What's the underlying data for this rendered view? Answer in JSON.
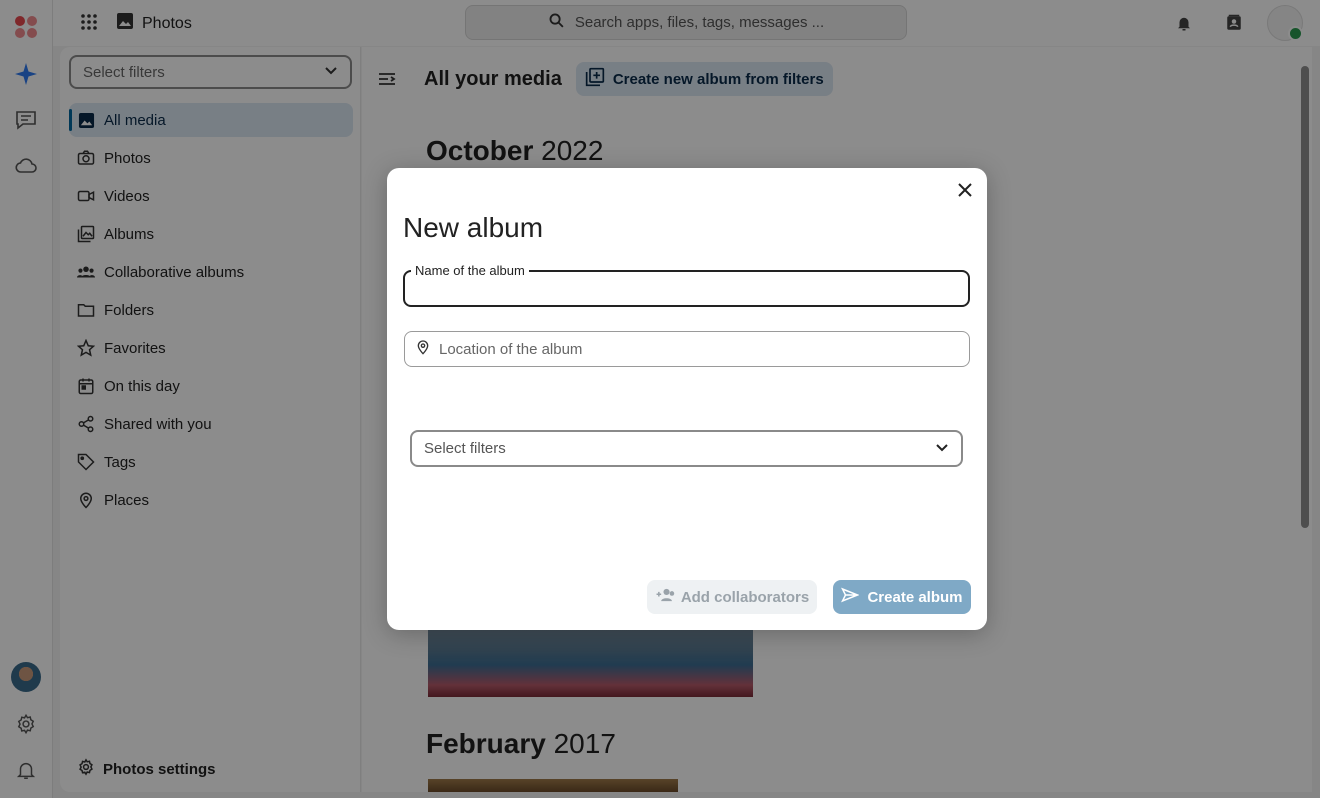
{
  "app": {
    "title": "Photos"
  },
  "search": {
    "placeholder": "Search apps, files, tags, messages ..."
  },
  "sidebar": {
    "filter_placeholder": "Select filters",
    "items": [
      {
        "label": "All media",
        "icon": "image-icon",
        "active": true
      },
      {
        "label": "Photos",
        "icon": "camera-icon"
      },
      {
        "label": "Videos",
        "icon": "video-icon"
      },
      {
        "label": "Albums",
        "icon": "albums-icon"
      },
      {
        "label": "Collaborative albums",
        "icon": "people-icon"
      },
      {
        "label": "Folders",
        "icon": "folder-icon"
      },
      {
        "label": "Favorites",
        "icon": "star-icon"
      },
      {
        "label": "On this day",
        "icon": "calendar-icon"
      },
      {
        "label": "Shared with you",
        "icon": "share-icon"
      },
      {
        "label": "Tags",
        "icon": "tag-icon"
      },
      {
        "label": "Places",
        "icon": "map-pin-icon"
      }
    ],
    "settings_label": "Photos settings"
  },
  "main": {
    "title": "All your media",
    "create_from_filters": "Create new album from filters",
    "sections": [
      {
        "month": "October",
        "year": "2022"
      },
      {
        "month": "February",
        "year": "2017"
      }
    ]
  },
  "modal": {
    "title": "New album",
    "name_label": "Name of the album",
    "name_value": "",
    "location_placeholder": "Location of the album",
    "filters_placeholder": "Select filters",
    "add_collaborators": "Add collaborators",
    "create_album": "Create album"
  },
  "colors": {
    "accent": "#00679e",
    "active_bg": "#dbe7f2",
    "create_btn": "#7fa9c6"
  }
}
